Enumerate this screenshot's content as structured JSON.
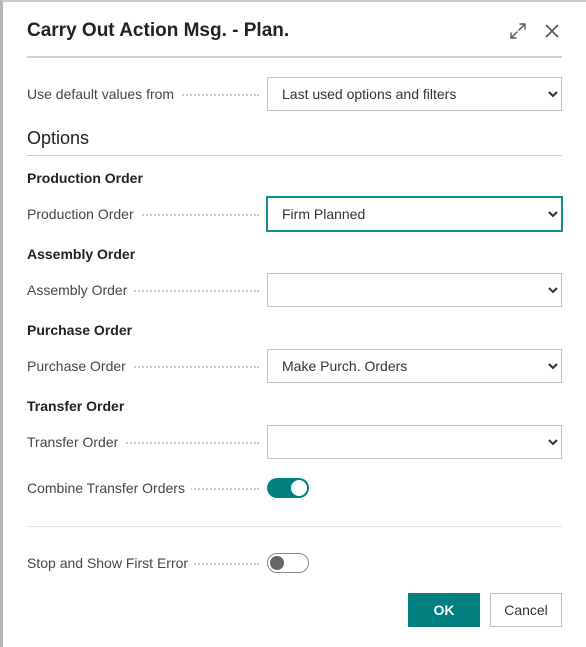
{
  "dialog": {
    "title": "Carry Out Action Msg. - Plan."
  },
  "defaults": {
    "label": "Use default values from",
    "value": "Last used options and filters"
  },
  "section_title": "Options",
  "groups": {
    "production": {
      "heading": "Production Order",
      "field_label": "Production Order",
      "value": "Firm Planned"
    },
    "assembly": {
      "heading": "Assembly Order",
      "field_label": "Assembly Order",
      "value": ""
    },
    "purchase": {
      "heading": "Purchase Order",
      "field_label": "Purchase Order",
      "value": "Make Purch. Orders"
    },
    "transfer": {
      "heading": "Transfer Order",
      "field_label": "Transfer Order",
      "value": ""
    }
  },
  "toggles": {
    "combine_label": "Combine Transfer Orders",
    "stop_label": "Stop and Show First Error"
  },
  "footer": {
    "ok": "OK",
    "cancel": "Cancel"
  }
}
